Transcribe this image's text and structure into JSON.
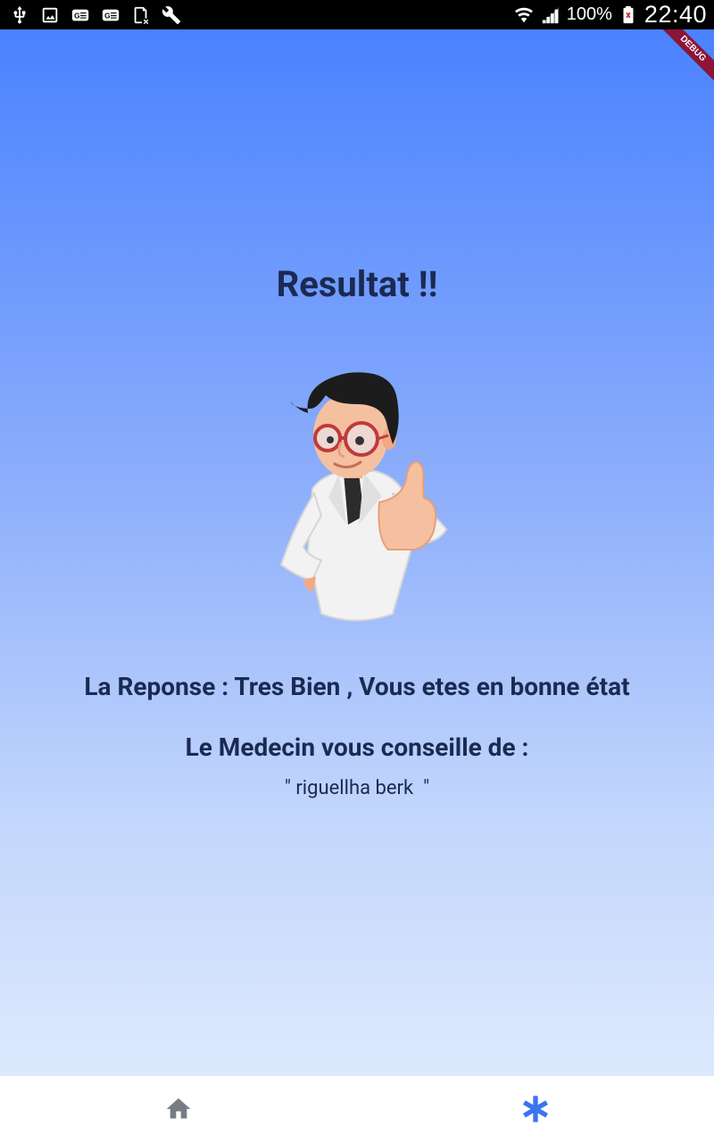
{
  "status_bar": {
    "battery_percent": "100%",
    "time": "22:40",
    "icons": [
      "usb-icon",
      "image-icon",
      "sim-icon",
      "sim-icon",
      "sim-error-icon",
      "wrench-icon",
      "wifi-icon",
      "signal-icon",
      "battery-icon"
    ]
  },
  "debug_banner": "DEBUG",
  "result": {
    "title": "Resultat !!",
    "response": "La Reponse : Tres Bien , Vous etes en bonne état",
    "advice_heading": "Le Medecin vous conseille de  :",
    "advice_text": "\" riguellha berk  \""
  },
  "bottom_nav": {
    "items": [
      {
        "icon": "home-icon",
        "color": "#777c85"
      },
      {
        "icon": "asterisk-icon",
        "color": "#3b74f0",
        "active": true
      }
    ]
  },
  "colors": {
    "gradient_top": "#4a82ff",
    "gradient_bottom": "#dde9fd",
    "text": "#1b2a52",
    "accent": "#3b74f0",
    "debug_ribbon": "#8a1538"
  }
}
